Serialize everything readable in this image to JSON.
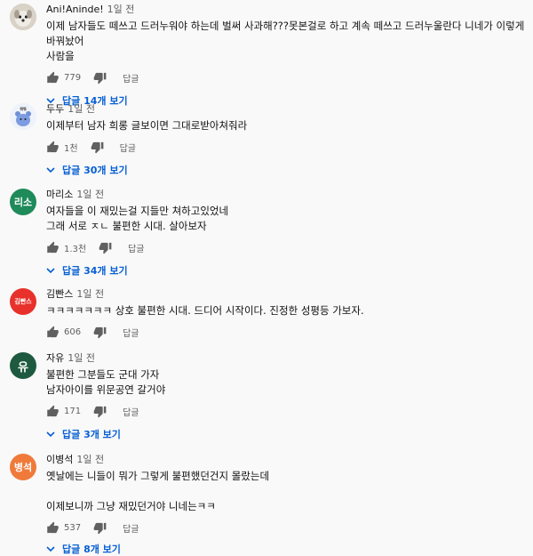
{
  "comments": [
    {
      "author": "Ani!Aninde!",
      "time": "1일 전",
      "text": "이제 남자들도 떼쓰고 드러누워야 하는데 벌써 사과해???못본걸로 하고 계속 떼쓰고 드러누울란다 니네가 이렇게 바꿔놨어\n사람을",
      "likes": "779",
      "reply_label": "답글",
      "replies_label": "답글 14개 보기",
      "avatar_text": "",
      "avatar_color": "#c9c3b8"
    },
    {
      "author": "두두",
      "time": "1일 전",
      "text": "이제부터 남자 희롱 글보이면 그대로받아쳐줘라",
      "likes": "1천",
      "reply_label": "답글",
      "replies_label": "답글 30개 보기",
      "avatar_text": "",
      "avatar_color": "#e9eef7"
    },
    {
      "author": "마리소",
      "time": "1일 전",
      "text": "여자들을 이 재밌는걸 지들만 쳐하고있었네\n그래 서로 ㅈㄴ 불편한 시대. 살아보자",
      "likes": "1.3천",
      "reply_label": "답글",
      "replies_label": "답글 34개 보기",
      "avatar_text": "리소",
      "avatar_color": "#1f8a5a"
    },
    {
      "author": "김빤스",
      "time": "1일 전",
      "text": "ㅋㅋㅋㅋㅋㅋㅋ 상호 불편한 시대. 드디어 시작이다. 진정한 성평등 가보자.",
      "likes": "606",
      "reply_label": "답글",
      "replies_label": "",
      "avatar_text": "김빤스",
      "avatar_color": "#e8312b"
    },
    {
      "author": "자유",
      "time": "1일 전",
      "text": "불편한 그분들도 군대 가자\n남자아이를 위문공연 갈거야",
      "likes": "171",
      "reply_label": "답글",
      "replies_label": "답글 3개 보기",
      "avatar_text": "유",
      "avatar_color": "#1d5a3f"
    },
    {
      "author": "이병석",
      "time": "1일 전",
      "text": "옛날에는 니들이 뭐가 그렇게 불편했던건지 몰랐는데\n\n이제보니까 그냥 재밌던거야 니네는ㅋㅋ",
      "likes": "537",
      "reply_label": "답글",
      "replies_label": "답글 8개 보기",
      "avatar_text": "병석",
      "avatar_color": "#ef7a3a"
    }
  ]
}
